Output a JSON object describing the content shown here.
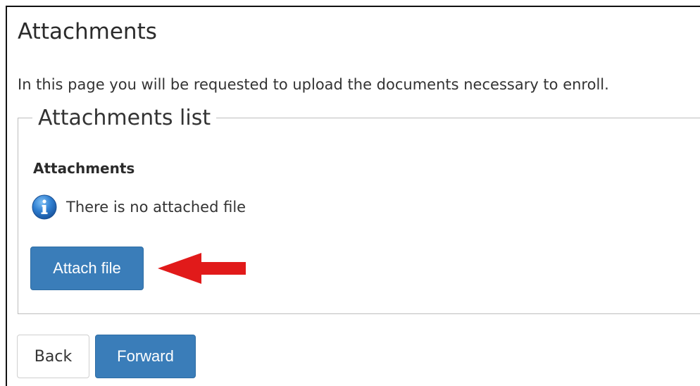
{
  "page": {
    "title": "Attachments",
    "intro": "In this page you will be requested to upload the documents necessary to enroll."
  },
  "attachments_list": {
    "legend": "Attachments list",
    "heading": "Attachments",
    "info_message": "There is no attached file",
    "info_icon": "info-circle-icon",
    "attach_button_label": "Attach file",
    "arrow_color": "#e11a1a"
  },
  "footer": {
    "back_label": "Back",
    "forward_label": "Forward"
  },
  "colors": {
    "primary_button": "#3a7db9",
    "info_icon": "#2f7fd1"
  }
}
